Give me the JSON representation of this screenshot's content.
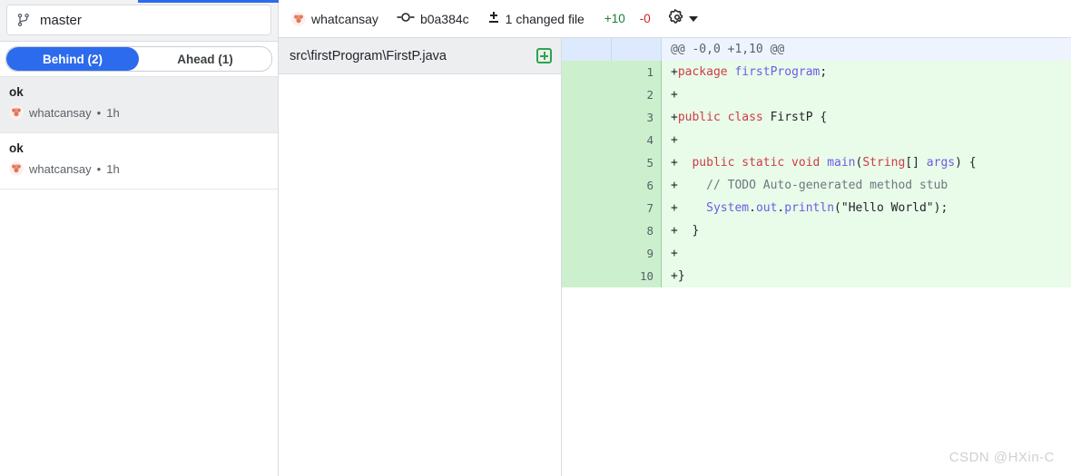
{
  "sidebar": {
    "branch": {
      "icon": "git-branch-icon",
      "name": "master"
    },
    "tabs": [
      {
        "label": "Behind (2)",
        "active": true
      },
      {
        "label": "Ahead (1)",
        "active": false
      }
    ],
    "commits": [
      {
        "title": "ok",
        "author": "whatcansay",
        "separator": "•",
        "time": "1h",
        "selected": true
      },
      {
        "title": "ok",
        "author": "whatcansay",
        "separator": "•",
        "time": "1h",
        "selected": false
      }
    ]
  },
  "commit_header": {
    "author": "whatcansay",
    "hash": "b0a384c",
    "changed_files": "1 changed file",
    "additions": "+10",
    "deletions": "-0",
    "gear_icon": "gear-icon"
  },
  "file_panel": {
    "file": {
      "path": "src\\firstProgram\\FirstP.java",
      "status_icon": "added-file-icon"
    }
  },
  "diff": {
    "hunk_header": "@@ -0,0 +1,10 @@",
    "lines": [
      {
        "num": "1",
        "marker": "+",
        "tokens": [
          {
            "t": "package ",
            "c": "k"
          },
          {
            "t": "firstProgram",
            "c": "id"
          },
          {
            "t": ";",
            "c": "pl"
          }
        ]
      },
      {
        "num": "2",
        "marker": "+",
        "tokens": [
          {
            "t": "",
            "c": "pl"
          }
        ]
      },
      {
        "num": "3",
        "marker": "+",
        "tokens": [
          {
            "t": "public class ",
            "c": "k"
          },
          {
            "t": "FirstP",
            "c": "pl"
          },
          {
            "t": " {",
            "c": "pl"
          }
        ]
      },
      {
        "num": "4",
        "marker": "+",
        "tokens": [
          {
            "t": "",
            "c": "pl"
          }
        ]
      },
      {
        "num": "5",
        "marker": "+",
        "tokens": [
          {
            "t": "  ",
            "c": "pl"
          },
          {
            "t": "public static void ",
            "c": "k"
          },
          {
            "t": "main",
            "c": "id"
          },
          {
            "t": "(",
            "c": "pl"
          },
          {
            "t": "String",
            "c": "k"
          },
          {
            "t": "[] ",
            "c": "pl"
          },
          {
            "t": "args",
            "c": "id"
          },
          {
            "t": ") {",
            "c": "pl"
          }
        ]
      },
      {
        "num": "6",
        "marker": "+",
        "tokens": [
          {
            "t": "    ",
            "c": "pl"
          },
          {
            "t": "// TODO Auto-generated method stub",
            "c": "cm"
          }
        ]
      },
      {
        "num": "7",
        "marker": "+",
        "tokens": [
          {
            "t": "    ",
            "c": "pl"
          },
          {
            "t": "System",
            "c": "id"
          },
          {
            "t": ".",
            "c": "pl"
          },
          {
            "t": "out",
            "c": "id"
          },
          {
            "t": ".",
            "c": "pl"
          },
          {
            "t": "println",
            "c": "id"
          },
          {
            "t": "(\"Hello World\");",
            "c": "pl"
          }
        ]
      },
      {
        "num": "8",
        "marker": "+",
        "tokens": [
          {
            "t": "  }",
            "c": "pl"
          }
        ]
      },
      {
        "num": "9",
        "marker": "+",
        "tokens": [
          {
            "t": "",
            "c": "pl"
          }
        ]
      },
      {
        "num": "10",
        "marker": "+",
        "tokens": [
          {
            "t": "}",
            "c": "pl"
          }
        ]
      }
    ]
  },
  "watermark": {
    "text": "CSDN @HXin-C"
  },
  "colors": {
    "accent": "#2c6bed",
    "add_bg": "#e9fbe9",
    "add_gutter": "#ccf0cd",
    "hunk_bg": "#eef4fd",
    "addition_text": "#1a7f37",
    "deletion_text": "#cf222e",
    "keyword": "#cf3c47",
    "identifier": "#6c5ce7",
    "comment": "#6e7781"
  }
}
